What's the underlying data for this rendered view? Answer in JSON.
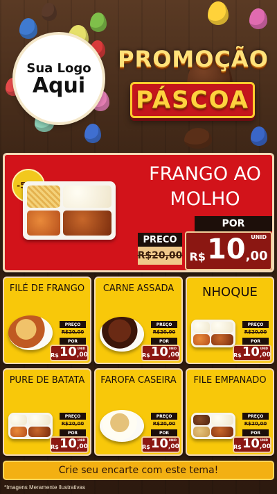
{
  "header": {
    "logo_line1": "Sua Logo",
    "logo_line2": "Aqui",
    "promo_title": "PROMOÇÃO",
    "promo_subtitle": "PÁSCOA"
  },
  "featured": {
    "discount": "-50%",
    "title_line1": "FRANGO AO",
    "title_line2": "MOLHO",
    "preco_label": "PRECO",
    "old_price": "R$20,00",
    "por_label": "POR",
    "currency": "R$",
    "new_price_int": "10",
    "new_price_cents": ",00",
    "unit": "UNID"
  },
  "price_labels": {
    "preco": "PREÇO",
    "old_price": "R$20,00",
    "por": "POR",
    "currency": "R$",
    "new_int": "10",
    "new_cents": ",00",
    "unit": "UNID"
  },
  "cards": [
    {
      "title": "FILÉ DE FRANGO"
    },
    {
      "title": "CARNE ASSADA"
    },
    {
      "title": "NHOQUE"
    },
    {
      "title": "PURE DE BATATA"
    },
    {
      "title": "FAROFA CASEIRA"
    },
    {
      "title": "FILE EMPANADO"
    }
  ],
  "footer": {
    "cta": "Crie seu encarte com este tema!",
    "disclaimer": "*Imagens Meramente Ilustrativas"
  },
  "colors": {
    "background": "#3b2415",
    "featured_bg": "#d2131a",
    "card_bg": "#f8c80a",
    "price_red": "#8b1712",
    "cta_bg": "#f3b012"
  }
}
